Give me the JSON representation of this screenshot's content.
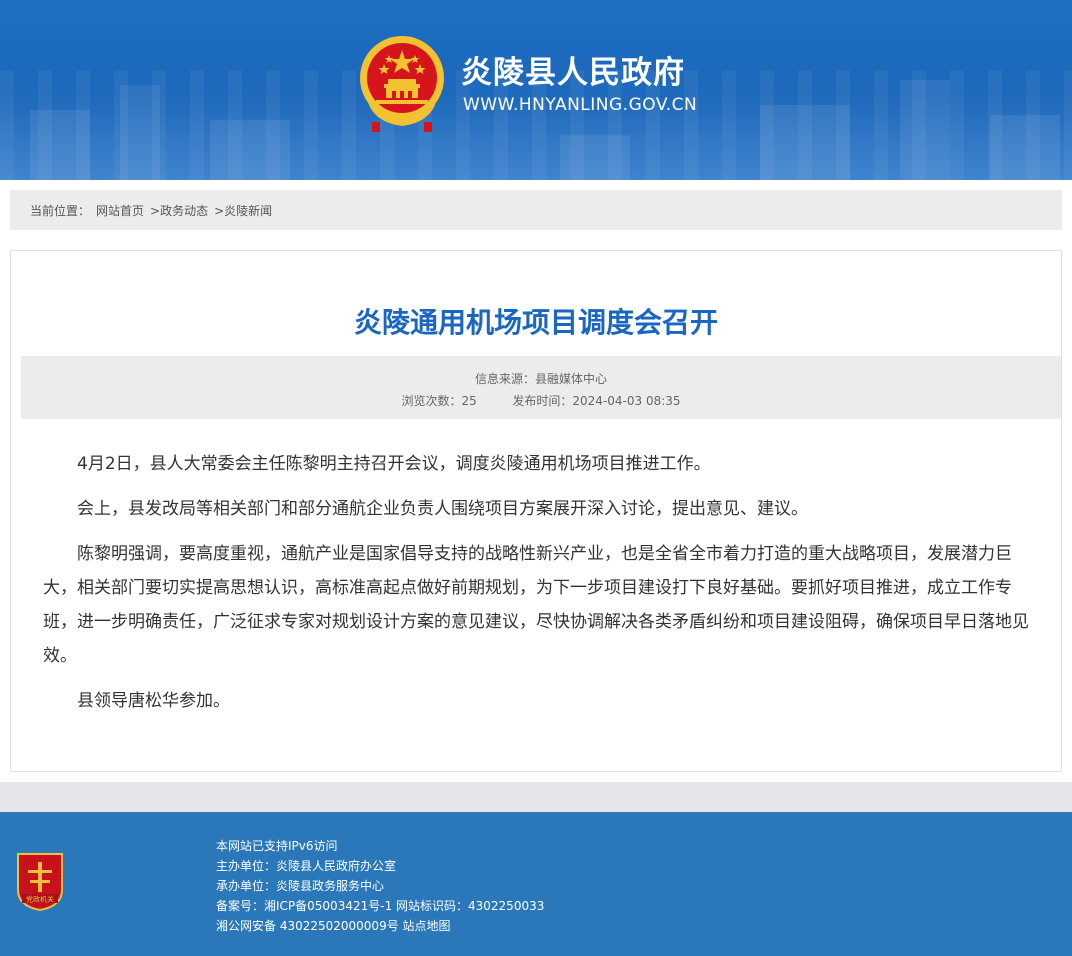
{
  "header": {
    "site_name": "炎陵县人民政府",
    "site_url": "WWW.HNYANLING.GOV.CN"
  },
  "breadcrumb": {
    "label": "当前位置：",
    "items": [
      "网站首页",
      ">政务动态",
      ">炎陵新闻"
    ]
  },
  "article": {
    "title": "炎陵通用机场项目调度会召开",
    "source_label": "信息来源：",
    "source": "县融媒体中心",
    "views_label": "浏览次数：",
    "views": "25",
    "published_label": "发布时间：",
    "published": "2024-04-03 08:35",
    "paragraphs": [
      "4月2日，县人大常委会主任陈黎明主持召开会议，调度炎陵通用机场项目推进工作。",
      "会上，县发改局等相关部门和部分通航企业负责人围绕项目方案展开深入讨论，提出意见、建议。",
      "陈黎明强调，要高度重视，通航产业是国家倡导支持的战略性新兴产业，也是全省全市着力打造的重大战略项目，发展潜力巨大，相关部门要切实提高思想认识，高标准高起点做好前期规划，为下一步项目建设打下良好基础。要抓好项目推进，成立工作专班，进一步明确责任，广泛征求专家对规划设计方案的意见建议，尽快协调解决各类矛盾纠纷和项目建设阻碍，确保项目早日落地见效。",
      "县领导唐松华参加。"
    ]
  },
  "footer": {
    "lines": [
      "本网站已支持IPv6访问",
      "主办单位：炎陵县人民政府办公室",
      "承办单位：炎陵县政务服务中心",
      "备案号：湘ICP备05003421号-1 网站标识码：4302250033",
      "湘公网安备 43022502000009号 站点地图"
    ],
    "badge_text": "党政机关"
  },
  "colors": {
    "header_blue": "#1f6fc4",
    "title_blue": "#1a66c1",
    "footer_blue": "#2a78b9",
    "emblem_red": "#d6141c",
    "emblem_gold": "#f2c230"
  }
}
